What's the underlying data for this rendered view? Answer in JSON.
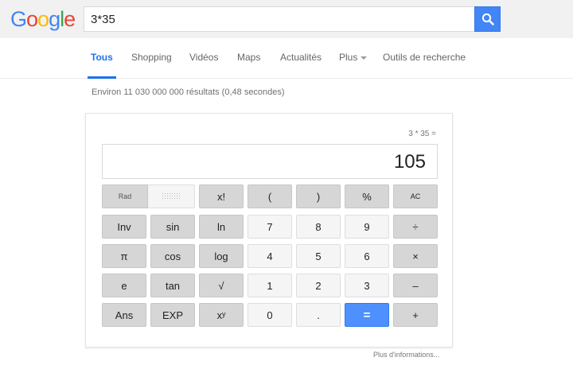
{
  "header": {
    "logo_letters": [
      "G",
      "o",
      "o",
      "g",
      "l",
      "e"
    ],
    "logo_colors": [
      "#4285f4",
      "#ea4335",
      "#fbbc05",
      "#4285f4",
      "#34a853",
      "#ea4335"
    ],
    "search_value": "3*35",
    "search_icon": "search-icon"
  },
  "tabs": {
    "items": [
      "Tous",
      "Shopping",
      "Vidéos",
      "Maps",
      "Actualités",
      "Plus",
      "Outils de recherche"
    ],
    "active": "Tous"
  },
  "result_stats": "Environ 11 030 000 000 résultats (0,48 secondes)",
  "calculator": {
    "expression": "3 * 35 =",
    "result": "105",
    "rad_label": "Rad",
    "keys": {
      "factorial": "x!",
      "open_paren": "(",
      "close_paren": ")",
      "percent": "%",
      "clear": "AC",
      "inv": "Inv",
      "sin": "sin",
      "ln": "ln",
      "d7": "7",
      "d8": "8",
      "d9": "9",
      "divide": "÷",
      "pi": "π",
      "cos": "cos",
      "log": "log",
      "d4": "4",
      "d5": "5",
      "d6": "6",
      "multiply": "×",
      "e": "e",
      "tan": "tan",
      "sqrt": "√",
      "d1": "1",
      "d2": "2",
      "d3": "3",
      "minus": "–",
      "ans": "Ans",
      "exp": "EXP",
      "power": "xʸ",
      "d0": "0",
      "dot": ".",
      "equals": "=",
      "plus": "+"
    }
  },
  "more_info": "Plus d'informations..."
}
